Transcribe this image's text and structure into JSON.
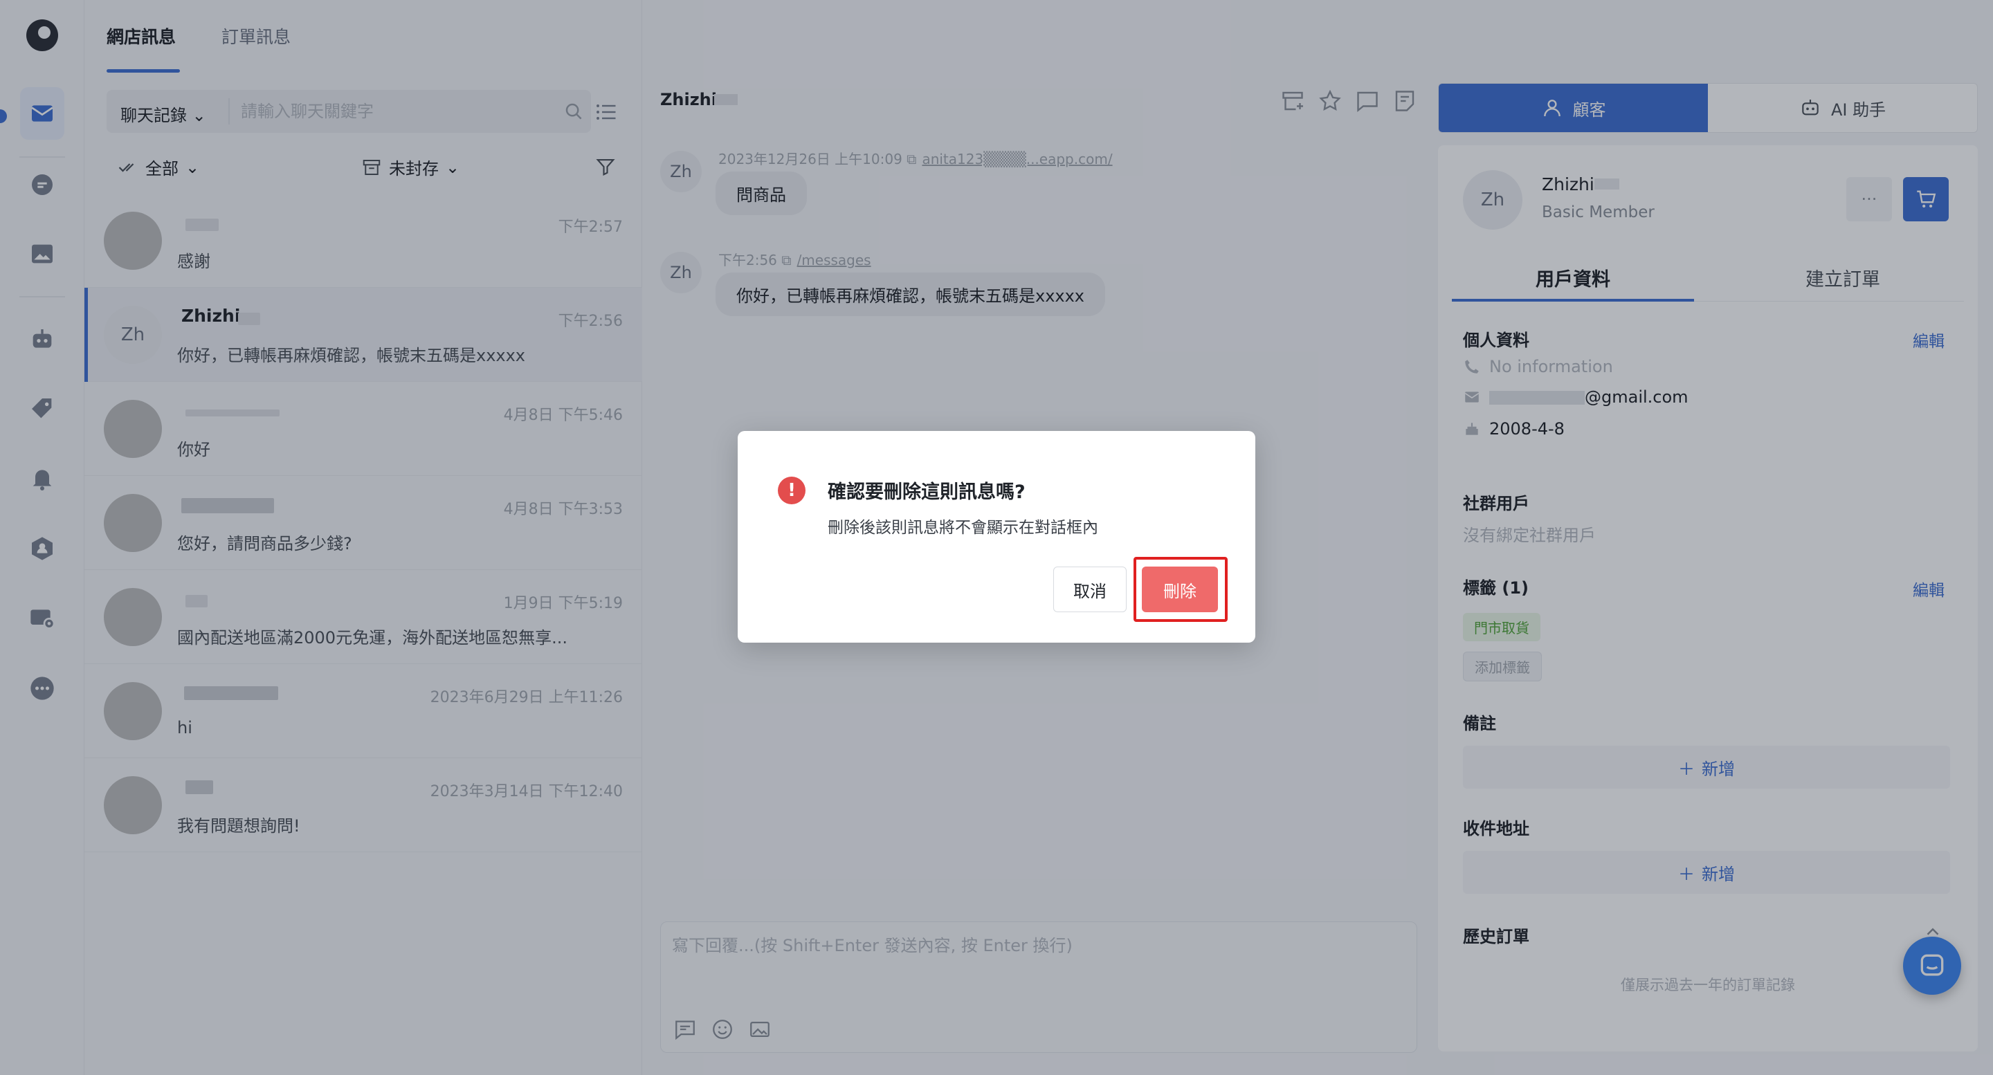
{
  "top_tabs": [
    "網店訊息",
    "訂單訊息"
  ],
  "search": {
    "select_label": "聊天記錄",
    "placeholder": "請輸入聊天關鍵字"
  },
  "filters": {
    "status": "全部",
    "archive": "未封存"
  },
  "conversations": [
    {
      "name": "",
      "time": "下午2:57",
      "preview": "感謝"
    },
    {
      "initials": "Zh",
      "name": "Zhizhi",
      "time": "下午2:56",
      "preview": "你好，已轉帳再麻煩確認，帳號末五碼是xxxxx"
    },
    {
      "name": "",
      "time": "4月8日 下午5:46",
      "preview": "你好"
    },
    {
      "name": "",
      "time": "4月8日 下午3:53",
      "preview": "您好，請問商品多少錢?"
    },
    {
      "name": "",
      "time": "1月9日 下午5:19",
      "preview": "國內配送地區滿2000元免運，海外配送地區恕無享..."
    },
    {
      "name": "",
      "time": "2023年6月29日 上午11:26",
      "preview": "hi"
    },
    {
      "name": "",
      "time": "2023年3月14日 下午12:40",
      "preview": "我有問題想詢問!"
    }
  ],
  "chat": {
    "title": "Zhizhi",
    "messages": [
      {
        "initials": "Zh",
        "time": "2023年12月26日 上午10:09",
        "link": "anita123▒▒▒▒...eapp.com/",
        "text": "問商品"
      },
      {
        "initials": "Zh",
        "time": "下午2:56",
        "link": "/messages",
        "text": "你好，已轉帳再麻煩確認，帳號末五碼是xxxxx"
      }
    ],
    "composer_placeholder": "寫下回覆...(按 Shift+Enter 發送內容, 按 Enter 換行)"
  },
  "side": {
    "tabs": [
      "顧客",
      "AI 助手"
    ],
    "profile": {
      "initials": "Zh",
      "name": "Zhizhi",
      "level": "Basic Member",
      "more": "···"
    },
    "sub_tabs": [
      "用戶資料",
      "建立訂單"
    ],
    "personal": {
      "title": "個人資料",
      "edit": "編輯",
      "phone": "No information",
      "email_suffix": "@gmail.com",
      "birthday": "2008-4-8"
    },
    "social": {
      "title": "社群用戶",
      "empty": "沒有綁定社群用戶"
    },
    "tags": {
      "title": "標籤 (1)",
      "edit": "編輯",
      "items": [
        "門市取貨"
      ],
      "add": "添加標籤"
    },
    "notes": {
      "title": "備註",
      "add": "新增"
    },
    "address": {
      "title": "收件地址",
      "add": "新增"
    },
    "history": {
      "title": "歷史訂單",
      "note": "僅展示過去一年的訂單記錄"
    }
  },
  "modal": {
    "icon": "!",
    "title": "確認要刪除這則訊息嗎?",
    "description": "刪除後該則訊息將不會顯示在對話框內",
    "cancel": "取消",
    "confirm": "刪除"
  },
  "colors": {
    "accent": "#3f6fd1",
    "danger": "#ef6a6a",
    "highlight": "#e02020"
  }
}
